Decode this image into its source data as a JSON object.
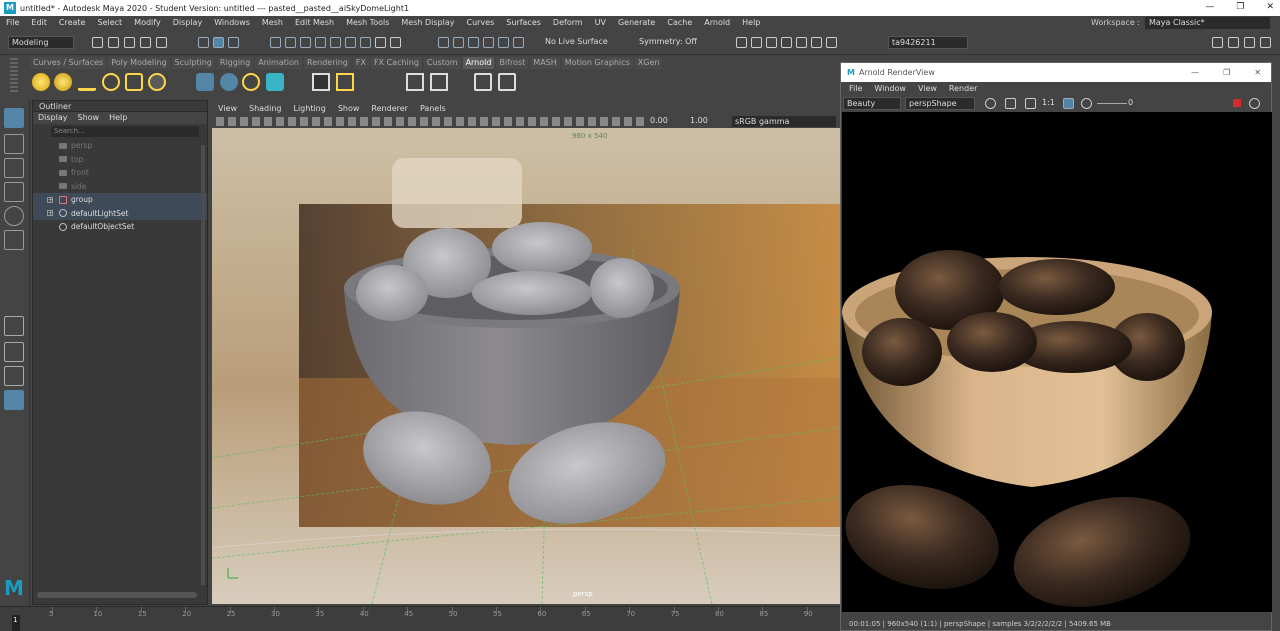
{
  "window": {
    "title": "untitled* - Autodesk Maya 2020 - Student Version: untitled   ---   pasted__pasted__aiSkyDomeLight1",
    "logo": "M",
    "controls": [
      "—",
      "❐",
      "✕"
    ]
  },
  "menubar": [
    "File",
    "Edit",
    "Create",
    "Select",
    "Modify",
    "Display",
    "Windows",
    "Mesh",
    "Edit Mesh",
    "Mesh Tools",
    "Mesh Display",
    "Curves",
    "Surfaces",
    "Deform",
    "UV",
    "Generate",
    "Cache",
    "Arnold",
    "Help"
  ],
  "workspace": {
    "label": "Workspace :",
    "value": "Maya Classic*"
  },
  "statusline": {
    "mode": "Modeling",
    "live_surface": "No Live Surface",
    "symmetry": "Symmetry: Off",
    "user": "ta9426211"
  },
  "shelf": {
    "tabs": [
      "Curves / Surfaces",
      "Poly Modeling",
      "Sculpting",
      "Rigging",
      "Animation",
      "Rendering",
      "FX",
      "FX Caching",
      "Custom",
      "Arnold",
      "Bifrost",
      "MASH",
      "Motion Graphics",
      "XGen"
    ],
    "active": "Arnold"
  },
  "outliner": {
    "title": "Outliner",
    "menu": [
      "Display",
      "Show",
      "Help"
    ],
    "search_placeholder": "Search...",
    "items": [
      {
        "label": "persp",
        "icon": "camera-icon",
        "dim": true
      },
      {
        "label": "top",
        "icon": "camera-icon",
        "dim": true
      },
      {
        "label": "front",
        "icon": "camera-icon",
        "dim": true
      },
      {
        "label": "side",
        "icon": "camera-icon",
        "dim": true
      },
      {
        "label": "group",
        "icon": "group-icon",
        "dim": false,
        "expand": true,
        "selected": true
      },
      {
        "label": "defaultLightSet",
        "icon": "set-icon",
        "dim": false,
        "expand": true,
        "selected": true
      },
      {
        "label": "defaultObjectSet",
        "icon": "set-icon",
        "dim": false,
        "expand": false,
        "selected": false
      }
    ]
  },
  "viewport": {
    "menu": [
      "View",
      "Shading",
      "Lighting",
      "Show",
      "Renderer",
      "Panels"
    ],
    "exposure": "0.00",
    "gamma": "1.00",
    "colorspace": "sRGB gamma",
    "resolution": "960 x 540",
    "camera": "persp"
  },
  "renderview": {
    "title": "Arnold RenderView",
    "menu": [
      "File",
      "Window",
      "View",
      "Render"
    ],
    "aov": "Beauty",
    "camera": "perspShape",
    "ratio": "1:1",
    "exposure": "0",
    "status": "00:01:05 | 960x540 (1:1) | perspShape | samples 3/2/2/2/2/2 | 5409.65 MB"
  },
  "timeline": {
    "ticks": [
      "5",
      "10",
      "15",
      "20",
      "25",
      "30",
      "35",
      "40",
      "45",
      "50",
      "55",
      "60",
      "65",
      "70",
      "75",
      "80",
      "85",
      "90"
    ],
    "current_frame": "1"
  },
  "colors": {
    "accent": "#5285a6",
    "maya_blue": "#1b9bbf",
    "bowl_render": "#d9b48a",
    "dates": "#3b2a20"
  }
}
